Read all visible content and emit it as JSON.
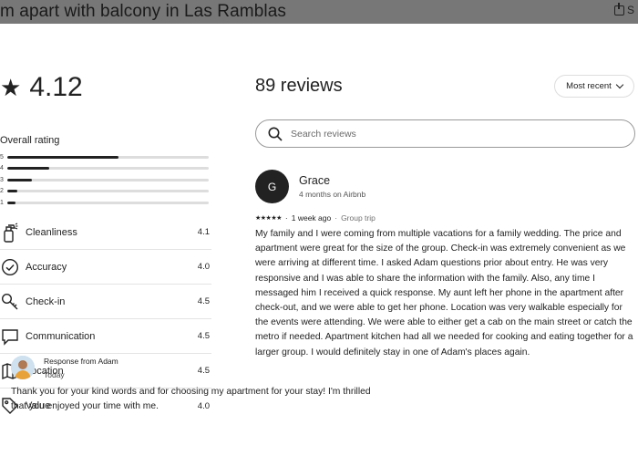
{
  "background": {
    "listing_title": "m apart with balcony in Las Ramblas",
    "share_label": "S"
  },
  "summary": {
    "rating": "4.12",
    "overall_label": "Overall rating",
    "distribution": [
      {
        "label": "5",
        "fraction": 0.55
      },
      {
        "label": "4",
        "fraction": 0.21
      },
      {
        "label": "3",
        "fraction": 0.12
      },
      {
        "label": "2",
        "fraction": 0.05
      },
      {
        "label": "1",
        "fraction": 0.04
      }
    ]
  },
  "categories": [
    {
      "name": "Cleanliness",
      "value": "4.1",
      "icon": "spray-bottle-icon"
    },
    {
      "name": "Accuracy",
      "value": "4.0",
      "icon": "check-circle-icon"
    },
    {
      "name": "Check-in",
      "value": "4.5",
      "icon": "key-icon"
    },
    {
      "name": "Communication",
      "value": "4.5",
      "icon": "chat-bubble-icon"
    },
    {
      "name": "Location",
      "value": "4.5",
      "icon": "map-icon"
    },
    {
      "name": "Value",
      "value": "4.0",
      "icon": "tag-icon"
    }
  ],
  "reviews_header": {
    "title": "89 reviews",
    "sort_label": "Most recent"
  },
  "search": {
    "placeholder": "Search reviews"
  },
  "review": {
    "avatar_initial": "G",
    "name": "Grace",
    "meta": "4 months on Airbnb",
    "stars": "★★★★★",
    "when": "1 week ago",
    "separator": "·",
    "trip_type": "Group trip",
    "body": "My family and I were coming from multiple vacations for a family wedding. The price and apartment were great for the size of the group. Check-in was extremely convenient as we were arriving at different time. I asked Adam questions prior about entry. He was very responsive and I was able to share the information with the family. Also, any time I messaged him I received a quick response. My aunt left her phone in the apartment after check-out, and we were able to get her phone. Location was very walkable especially for the events were attending. We were able to either get a cab on the main street or catch the metro if needed. Apartment kitchen had all we needed for cooking and eating together for a larger group. I would definitely stay in one of Adam's places again.",
    "response": {
      "title": "Response from Adam",
      "date": "Today",
      "body": "Thank you for your kind words and for choosing my apartment for your stay! I'm thrilled that you enjoyed your time with me."
    }
  },
  "colors": {
    "text": "#222222",
    "muted": "#717171",
    "divider": "#e4e4e4",
    "bar_track": "#dddddd"
  }
}
